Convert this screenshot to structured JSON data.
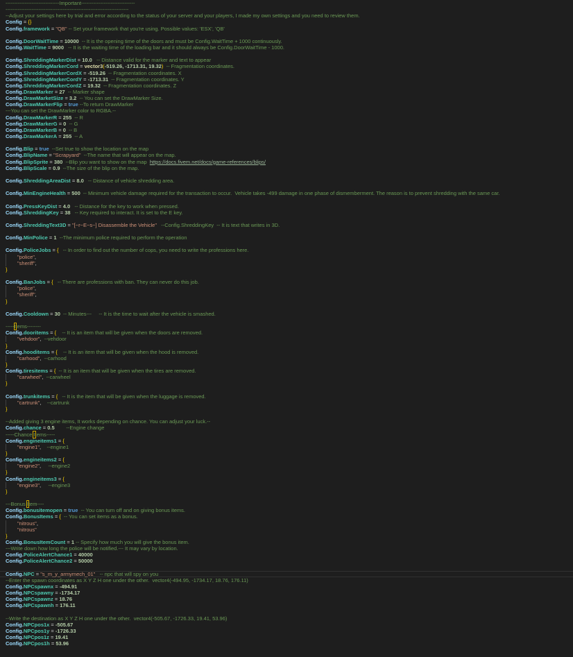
{
  "lines": [
    [
      [
        "c",
        "-------------------------------Important-------------------------------"
      ]
    ],
    [
      [
        "c",
        "-----------------------------------------------------------------------"
      ]
    ],
    [
      [
        "c",
        "--Adjust your settings here by trial and error according to the status of your server and your players, I made my own settings and you need to review them."
      ]
    ],
    [
      [
        "k",
        "Config"
      ],
      [
        "o",
        " = "
      ],
      [
        "y",
        "{}"
      ]
    ],
    [
      [
        "k",
        "Config."
      ],
      [
        "p",
        "framework"
      ],
      [
        "o",
        " = "
      ],
      [
        "s",
        "\"QB\""
      ],
      [
        "c",
        " -- Set your framework that you're using. Possible values: 'ESX', 'QB'"
      ]
    ],
    [],
    [
      [
        "k",
        "Config."
      ],
      [
        "p",
        "DoorWaitTime"
      ],
      [
        "o",
        " = "
      ],
      [
        "n",
        "10000"
      ],
      [
        "c",
        "  -- It is the opening time of the doors and must be Config.WaitTime + 1000 continuously."
      ]
    ],
    [
      [
        "k",
        "Config."
      ],
      [
        "p",
        "WaitTime"
      ],
      [
        "o",
        " = "
      ],
      [
        "n",
        "9000"
      ],
      [
        "c",
        "   -- It is the waiting time of the loading bar and it should always be Config.DoorWaitTime - 1000."
      ]
    ],
    [],
    [
      [
        "k",
        "Config."
      ],
      [
        "p",
        "ShreddingMarkerDist"
      ],
      [
        "o",
        " = "
      ],
      [
        "n",
        "10.0"
      ],
      [
        "c",
        "   -- Distance valid for the marker and text to appear"
      ]
    ],
    [
      [
        "k",
        "Config."
      ],
      [
        "p",
        "ShreddingMarkerCord"
      ],
      [
        "o",
        " = "
      ],
      [
        "f",
        "vector3"
      ],
      [
        "y",
        "("
      ],
      [
        "n",
        "-519.26, -1713.31, 19.32"
      ],
      [
        "y",
        ")"
      ],
      [
        "c",
        "  -- Fragmentation coordinates."
      ]
    ],
    [
      [
        "k",
        "Config."
      ],
      [
        "p",
        "ShreddingMarkerCordX"
      ],
      [
        "o",
        " = "
      ],
      [
        "n",
        "-519.26"
      ],
      [
        "c",
        "  -- Fragmentation coordinates. X"
      ]
    ],
    [
      [
        "k",
        "Config."
      ],
      [
        "p",
        "ShreddingMarkerCordY"
      ],
      [
        "o",
        " = "
      ],
      [
        "n",
        "-1713.31"
      ],
      [
        "c",
        "  -- Fragmentation coordinates. Y"
      ]
    ],
    [
      [
        "k",
        "Config."
      ],
      [
        "p",
        "ShreddingMarkerCordZ"
      ],
      [
        "o",
        " = "
      ],
      [
        "n",
        "19.32"
      ],
      [
        "c",
        "  -- Fragmentation coordinates. Z"
      ]
    ],
    [
      [
        "k",
        "Config."
      ],
      [
        "p",
        "DrawMarker"
      ],
      [
        "o",
        " = "
      ],
      [
        "n",
        "27"
      ],
      [
        "c",
        "  -- Marker shape"
      ]
    ],
    [
      [
        "k",
        "Config."
      ],
      [
        "p",
        "DrawMarketSize"
      ],
      [
        "o",
        " = "
      ],
      [
        "n",
        "3.2"
      ],
      [
        "c",
        "  -- You can set the DrawMarker Size."
      ]
    ],
    [
      [
        "k",
        "Config."
      ],
      [
        "p",
        "DrawMarkerFlip"
      ],
      [
        "o",
        " = "
      ],
      [
        "b",
        "true"
      ],
      [
        "c",
        " --To return DrawMarker"
      ]
    ],
    [
      [
        "c",
        "---You can set the DrawMarker color to RGBA.--"
      ]
    ],
    [
      [
        "k",
        "Config."
      ],
      [
        "p",
        "DrawMarkerR"
      ],
      [
        "o",
        " = "
      ],
      [
        "n",
        "255"
      ],
      [
        "c",
        "  -- R"
      ]
    ],
    [
      [
        "k",
        "Config."
      ],
      [
        "p",
        "DrawMarkerG"
      ],
      [
        "o",
        " = "
      ],
      [
        "n",
        "0"
      ],
      [
        "c",
        "  -- G"
      ]
    ],
    [
      [
        "k",
        "Config."
      ],
      [
        "p",
        "DrawMarkerB"
      ],
      [
        "o",
        " = "
      ],
      [
        "n",
        "0"
      ],
      [
        "c",
        "  -- B"
      ]
    ],
    [
      [
        "k",
        "Config."
      ],
      [
        "p",
        "DrawMarkerA"
      ],
      [
        "o",
        " = "
      ],
      [
        "n",
        "255"
      ],
      [
        "c",
        "  -- A"
      ]
    ],
    [],
    [
      [
        "k",
        "Config."
      ],
      [
        "p",
        "Blip"
      ],
      [
        "o",
        " = "
      ],
      [
        "b",
        "true"
      ],
      [
        "c",
        "  --Set true to show the location on the map"
      ]
    ],
    [
      [
        "k",
        "Config."
      ],
      [
        "p",
        "BlipName"
      ],
      [
        "o",
        " = "
      ],
      [
        "s",
        "\"Scrapyard\""
      ],
      [
        "c",
        "  --The name that will appear on the map."
      ]
    ],
    [
      [
        "k",
        "Config."
      ],
      [
        "p",
        "BlipSprite"
      ],
      [
        "o",
        " = "
      ],
      [
        "n",
        "380"
      ],
      [
        "c",
        "  --Blip you want to show on the map  "
      ],
      [
        "u",
        "https://docs.fivem.net/docs/game-references/blips/"
      ]
    ],
    [
      [
        "k",
        "Config."
      ],
      [
        "p",
        "BlipScale"
      ],
      [
        "o",
        " = "
      ],
      [
        "n",
        "0.9"
      ],
      [
        "c",
        "  --The size of the blip on the map."
      ]
    ],
    [],
    [
      [
        "k",
        "Config."
      ],
      [
        "p",
        "ShreddingAreaDist"
      ],
      [
        "o",
        " = "
      ],
      [
        "n",
        "8.0"
      ],
      [
        "c",
        "   -- Distance of vehicle shredding area."
      ]
    ],
    [],
    [
      [
        "k",
        "Config."
      ],
      [
        "p",
        "MinEngineHealth"
      ],
      [
        "o",
        " = "
      ],
      [
        "n",
        "500"
      ],
      [
        "c",
        "  -- Minimum vehicle damage required for the transaction to occur.  Vehicle takes -499 damage in one phase of dismemberment. The reason is to prevent shredding with the same car."
      ]
    ],
    [],
    [
      [
        "k",
        "Config."
      ],
      [
        "p",
        "PressKeyDist"
      ],
      [
        "o",
        " = "
      ],
      [
        "n",
        "4.0"
      ],
      [
        "c",
        "   -- Distance for the key to work when pressed."
      ]
    ],
    [
      [
        "k",
        "Config."
      ],
      [
        "p",
        "ShreddingKey"
      ],
      [
        "o",
        " = "
      ],
      [
        "n",
        "38"
      ],
      [
        "c",
        "   -- Key required to interact. It is set to the E key."
      ]
    ],
    [],
    [
      [
        "k",
        "Config."
      ],
      [
        "p",
        "ShreddingText3D"
      ],
      [
        "o",
        " = "
      ],
      [
        "s",
        "\"[~r~E~s~] Disassemble the Vehicle\""
      ],
      [
        "c",
        "   --Config.ShreddingKey  -- It is text that writes in 3D."
      ]
    ],
    [],
    [
      [
        "k",
        "Config."
      ],
      [
        "p",
        "MinPolice"
      ],
      [
        "o",
        " = "
      ],
      [
        "n",
        "1"
      ],
      [
        "c",
        "  --The minimum police required to perform the operation"
      ]
    ],
    [],
    [
      [
        "k",
        "Config."
      ],
      [
        "p",
        "PoliceJobs"
      ],
      [
        "o",
        " = "
      ],
      [
        "y",
        "{"
      ],
      [
        "c",
        "   -- In order to find out the number of cops, you need to write the professions here."
      ]
    ],
    [
      [
        "ind",
        ""
      ],
      [
        "s",
        "\"police\""
      ],
      [
        "o",
        ","
      ]
    ],
    [
      [
        "ind",
        ""
      ],
      [
        "s",
        "\"sheriff\""
      ],
      [
        "o",
        ","
      ]
    ],
    [
      [
        "y",
        "}"
      ]
    ],
    [],
    [
      [
        "k",
        "Config."
      ],
      [
        "p",
        "BanJobs"
      ],
      [
        "o",
        " = "
      ],
      [
        "y",
        "{"
      ],
      [
        "c",
        "   -- There are professions with ban. They can never do this job."
      ]
    ],
    [
      [
        "ind",
        ""
      ],
      [
        "s",
        "\"police\""
      ],
      [
        "o",
        ","
      ]
    ],
    [
      [
        "ind",
        ""
      ],
      [
        "s",
        "\"sheriff\""
      ],
      [
        "o",
        ","
      ]
    ],
    [
      [
        "y",
        "}"
      ]
    ],
    [],
    [
      [
        "k",
        "Config."
      ],
      [
        "p",
        "Cooldown"
      ],
      [
        "o",
        " = "
      ],
      [
        "n",
        "30"
      ],
      [
        "c",
        "  -- Minutes---     -- It is the time to wait after the vehicle is smashed."
      ]
    ],
    [],
    [
      [
        "c",
        "-----"
      ],
      [
        "hl",
        "I"
      ],
      [
        "c",
        "tems--------"
      ]
    ],
    [
      [
        "k",
        "Config."
      ],
      [
        "p",
        "dooritems"
      ],
      [
        "o",
        " = "
      ],
      [
        "y",
        "{"
      ],
      [
        "c",
        "    -- It is an item that will be given when the doors are removed."
      ]
    ],
    [
      [
        "ind",
        ""
      ],
      [
        "s",
        "\"vehdoor\""
      ],
      [
        "o",
        ","
      ],
      [
        "c",
        "  --vehdoor"
      ]
    ],
    [
      [
        "y",
        "}"
      ]
    ],
    [
      [
        "k",
        "Config."
      ],
      [
        "p",
        "hooditems"
      ],
      [
        "o",
        " = "
      ],
      [
        "y",
        "{"
      ],
      [
        "c",
        "    -- It is an item that will be given when the hood is removed."
      ]
    ],
    [
      [
        "ind",
        ""
      ],
      [
        "s",
        "\"carhood\""
      ],
      [
        "o",
        ","
      ],
      [
        "c",
        "  --carhood"
      ]
    ],
    [
      [
        "y",
        "}"
      ]
    ],
    [
      [
        "k",
        "Config."
      ],
      [
        "p",
        "tiresitems"
      ],
      [
        "o",
        " = "
      ],
      [
        "y",
        "{"
      ],
      [
        "c",
        "  -- It is an item that will be given when the tires are removed."
      ]
    ],
    [
      [
        "ind",
        ""
      ],
      [
        "s",
        "\"carwheel\""
      ],
      [
        "o",
        ","
      ],
      [
        "c",
        "  --carwheel"
      ]
    ],
    [
      [
        "y",
        "}"
      ]
    ],
    [],
    [
      [
        "k",
        "Config."
      ],
      [
        "p",
        "trunkitems"
      ],
      [
        "o",
        " = "
      ],
      [
        "y",
        "{"
      ],
      [
        "c",
        "   -- It is the item that will be given when the luggage is removed."
      ]
    ],
    [
      [
        "ind",
        ""
      ],
      [
        "s",
        "\"cartrunk\""
      ],
      [
        "o",
        ","
      ],
      [
        "c",
        "    --cartrunk"
      ]
    ],
    [
      [
        "y",
        "}"
      ]
    ],
    [],
    [
      [
        "c",
        "--Added giving 3 engine items, It works depending on chance. You can adjust your luck.--"
      ]
    ],
    [
      [
        "k",
        "Config."
      ],
      [
        "p",
        "chance"
      ],
      [
        "o",
        " = "
      ],
      [
        "n",
        "0.5"
      ],
      [
        "c",
        "        --Engine change"
      ]
    ],
    [
      [
        "c",
        "-----Chance "
      ],
      [
        "hl",
        "I"
      ],
      [
        "c",
        "tems-----"
      ]
    ],
    [
      [
        "k",
        "Config."
      ],
      [
        "p",
        "engineitems1"
      ],
      [
        "o",
        " = "
      ],
      [
        "y",
        "{"
      ]
    ],
    [
      [
        "ind",
        ""
      ],
      [
        "s",
        "\"engine1\""
      ],
      [
        "o",
        ","
      ],
      [
        "c",
        "    --engine1"
      ]
    ],
    [
      [
        "y",
        "}"
      ]
    ],
    [
      [
        "k",
        "Config."
      ],
      [
        "p",
        "engineitems2"
      ],
      [
        "o",
        " = "
      ],
      [
        "y",
        "{"
      ]
    ],
    [
      [
        "ind",
        ""
      ],
      [
        "s",
        "\"engine2\""
      ],
      [
        "o",
        ","
      ],
      [
        "c",
        "     --engine2"
      ]
    ],
    [
      [
        "y",
        "}"
      ]
    ],
    [
      [
        "k",
        "Config."
      ],
      [
        "p",
        "engineitems3"
      ],
      [
        "o",
        " = "
      ],
      [
        "y",
        "{"
      ]
    ],
    [
      [
        "ind",
        ""
      ],
      [
        "s",
        "\"engine3\""
      ],
      [
        "o",
        ","
      ],
      [
        "c",
        "     --engine3"
      ]
    ],
    [
      [
        "y",
        "}"
      ]
    ],
    [],
    [
      [
        "c",
        "---Bonus "
      ],
      [
        "hl",
        "I"
      ],
      [
        "c",
        "tem----"
      ]
    ],
    [
      [
        "k",
        "Config."
      ],
      [
        "p",
        "bonusitemopen"
      ],
      [
        "o",
        " = "
      ],
      [
        "b",
        "true"
      ],
      [
        "c",
        "  -- You can turn off and on giving bonus items."
      ]
    ],
    [
      [
        "k",
        "Config."
      ],
      [
        "p",
        "BonusItems"
      ],
      [
        "o",
        " = "
      ],
      [
        "y",
        "{"
      ],
      [
        "c",
        "  -- You can set items as a bonus."
      ]
    ],
    [
      [
        "ind",
        ""
      ],
      [
        "s",
        "\"nitrous\""
      ],
      [
        "o",
        ","
      ]
    ],
    [
      [
        "ind",
        ""
      ],
      [
        "s",
        "\"nitrous\""
      ]
    ],
    [
      [
        "y",
        "}"
      ]
    ],
    [
      [
        "k",
        "Config."
      ],
      [
        "p",
        "BonusItemCount"
      ],
      [
        "o",
        " = "
      ],
      [
        "n",
        "1"
      ],
      [
        "c",
        " -- Specify how much you will give the bonus item."
      ]
    ],
    [
      [
        "c",
        "---Write down how long the police will be notified.--- It may vary by location."
      ]
    ],
    [
      [
        "k",
        "Config."
      ],
      [
        "p",
        "PoliceAlertChance1"
      ],
      [
        "o",
        " = "
      ],
      [
        "n",
        "40000"
      ]
    ],
    [
      [
        "k",
        "Config."
      ],
      [
        "p",
        "PoliceAlertChance2"
      ],
      [
        "o",
        " = "
      ],
      [
        "n",
        "50000"
      ]
    ],
    [],
    [
      [
        "k",
        "Config."
      ],
      [
        "p",
        "NPC"
      ],
      [
        "o",
        " = "
      ],
      [
        "s",
        "\"s_m_y_armymech_01\""
      ],
      [
        "c",
        "   -- npc that will spy on you"
      ]
    ],
    [
      [
        "c",
        "--Enter the spawn coordinates as X Y Z H one under the other.  vector4(-494.95, -1734.17, 18.76, 176.11)"
      ]
    ],
    [
      [
        "k",
        "Config."
      ],
      [
        "p",
        "NPCspawnx"
      ],
      [
        "o",
        " = "
      ],
      [
        "n",
        "-494.91"
      ]
    ],
    [
      [
        "k",
        "Config."
      ],
      [
        "p",
        "NPCspawny"
      ],
      [
        "o",
        " = "
      ],
      [
        "n",
        "-1734.17"
      ]
    ],
    [
      [
        "k",
        "Config."
      ],
      [
        "p",
        "NPCspawnz"
      ],
      [
        "o",
        " = "
      ],
      [
        "n",
        "18.76"
      ]
    ],
    [
      [
        "k",
        "Config."
      ],
      [
        "p",
        "NPCspawnh"
      ],
      [
        "o",
        " = "
      ],
      [
        "n",
        "176.11"
      ]
    ],
    [],
    [
      [
        "c",
        "--Write the destination as X Y Z H one under the other.  vector4(-505.67, -1726.33, 19.41, 53.96)"
      ]
    ],
    [
      [
        "k",
        "Config."
      ],
      [
        "p",
        "NPCpos1x"
      ],
      [
        "o",
        " = "
      ],
      [
        "n",
        "-505.67"
      ]
    ],
    [
      [
        "k",
        "Config."
      ],
      [
        "p",
        "NPCpos1y"
      ],
      [
        "o",
        " = "
      ],
      [
        "n",
        "-1726.33"
      ]
    ],
    [
      [
        "k",
        "Config."
      ],
      [
        "p",
        "NPCpos1z"
      ],
      [
        "o",
        " = "
      ],
      [
        "n",
        "19.41"
      ]
    ],
    [
      [
        "k",
        "Config."
      ],
      [
        "p",
        "NPCpos1h"
      ],
      [
        "o",
        " = "
      ],
      [
        "n",
        "53.96"
      ]
    ]
  ],
  "colors": {
    "background": "#1e1e1e",
    "config": "#9cdcfe",
    "property": "#4ec9b0",
    "comment": "#6a9955",
    "string": "#ce9178",
    "number": "#b5cea8",
    "keyword": "#569cd6",
    "brace": "#ffd700"
  }
}
